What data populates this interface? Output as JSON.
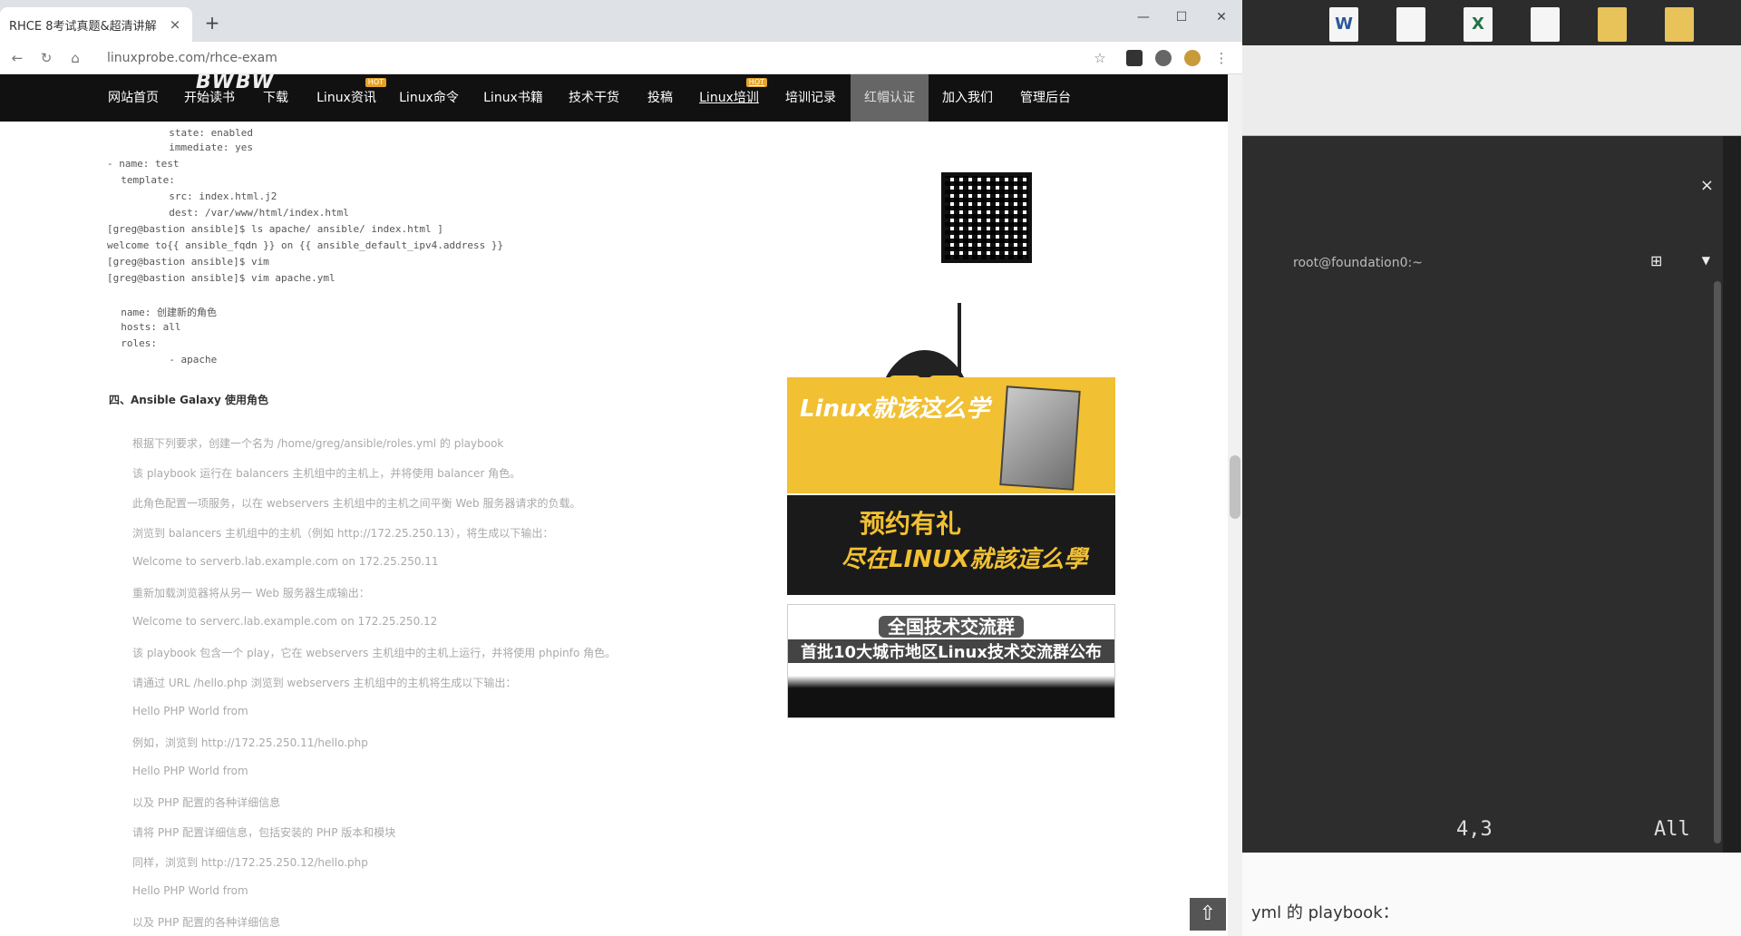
{
  "browser": {
    "tab_title": "RHCE 8考试真题&超清讲解",
    "tab_close": "×",
    "new_tab": "+",
    "win_min": "—",
    "win_max": "☐",
    "win_close": "✕",
    "address": "linuxprobe.com/rhce-exam"
  },
  "site_nav": {
    "logo": "BWBW",
    "items": [
      {
        "label": "网站首页"
      },
      {
        "label": "开始读书"
      },
      {
        "label": "下载"
      },
      {
        "label": "Linux资讯",
        "badge": "HOT"
      },
      {
        "label": "Linux命令"
      },
      {
        "label": "Linux书籍"
      },
      {
        "label": "技术干货"
      },
      {
        "label": "投稿"
      },
      {
        "label": "Linux培训",
        "badge": "HOT"
      },
      {
        "label": "培训记录"
      },
      {
        "label": "红帽认证"
      },
      {
        "label": "加入我们"
      },
      {
        "label": "管理后台"
      }
    ]
  },
  "content": {
    "code_lines": [
      "          state: enabled",
      "          immediate: yes",
      "- name: test",
      "  template:",
      "          src: index.html.j2",
      "          dest: /var/www/html/index.html",
      "[greg@bastion ansible]$ ls apache/ ansible/ index.html ]",
      "welcome to{{ ansible_fqdn }} on {{ ansible_default_ipv4.address }}",
      "[greg@bastion ansible]$ vim",
      "[greg@bastion ansible]$ vim apache.yml",
      "  name: 创建新的角色",
      "  hosts: all",
      "  roles:",
      "          - apache"
    ],
    "section_title": "四、Ansible Galaxy 使用角色",
    "paragraphs": [
      "根据下列要求，创建一个名为 /home/greg/ansible/roles.yml 的 playbook",
      "该 playbook 运行在 balancers 主机组中的主机上，并将使用 balancer 角色。",
      "此角色配置一项服务，以在 webservers 主机组中的主机之间平衡 Web 服务器请求的负载。",
      "浏览到 balancers 主机组中的主机（例如 http://172.25.250.13），将生成以下输出：",
      "Welcome to serverb.lab.example.com on 172.25.250.11",
      "重新加载浏览器将从另一 Web 服务器生成输出：",
      "Welcome to serverc.lab.example.com on 172.25.250.12",
      "该 playbook 包含一个 play，它在 webservers 主机组中的主机上运行，并将使用 phpinfo 角色。",
      "请通过 URL /hello.php 浏览到 webservers 主机组中的主机将生成以下输出：",
      "Hello PHP World from",
      "例如，浏览到 http://172.25.250.11/hello.php",
      "Hello PHP World from",
      "以及 PHP 配置的各种详细信息",
      "请将 PHP 配置详细信息，包括安装的 PHP 版本和模块",
      "同样，浏览到 http://172.25.250.12/hello.php",
      "Hello PHP World from",
      "以及 PHP 配置的各种详细信息"
    ]
  },
  "ads": {
    "ad1_title": "Linux就该这么学",
    "ad2_title": "预约有礼",
    "ad2_sub": "尽在LINUX就該這么學",
    "ad3_title": "全国技术交流群",
    "ad3_sub": "首批10大城市地区Linux技术交流群公布"
  },
  "back_to_top": "⇧",
  "desktop": {
    "icons": [
      "W",
      "",
      "X",
      "",
      "",
      ""
    ]
  },
  "terminal": {
    "close": "×",
    "title": "root@foundation0:~",
    "position": "4,3",
    "all": "All",
    "below_snippet": "yml 的 playbook："
  }
}
